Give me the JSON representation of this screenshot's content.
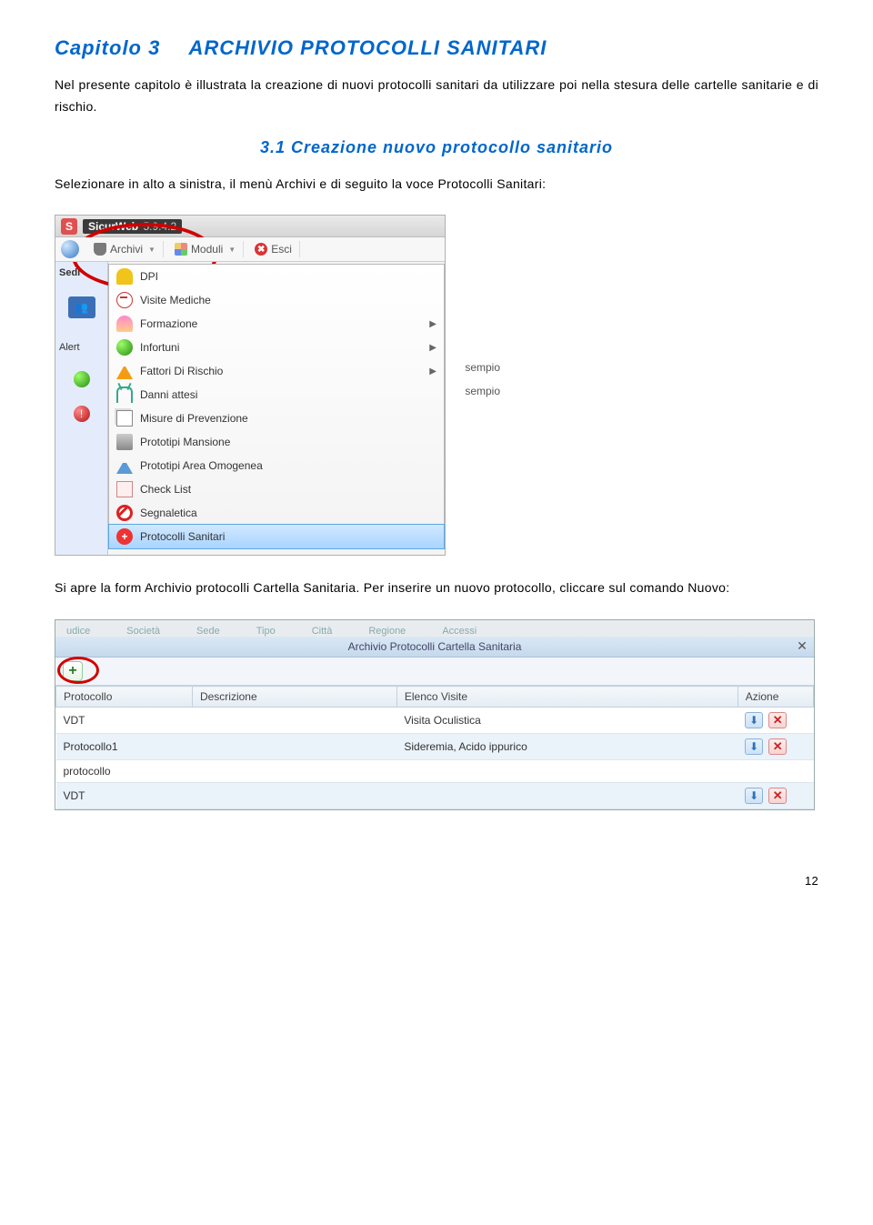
{
  "chapter": {
    "number": "Capitolo 3",
    "title": "ARCHIVIO PROTOCOLLI SANITARI"
  },
  "intro": "Nel presente capitolo è illustrata la creazione di nuovi protocolli sanitari da utilizzare poi nella stesura delle cartelle sanitarie e di rischio.",
  "section": {
    "number": "3.1",
    "title": "Creazione nuovo protocollo sanitario"
  },
  "para2": "Selezionare in alto a sinistra, il menù Archivi e di seguito la voce Protocolli Sanitari:",
  "para3": "Si apre la form Archivio protocolli Cartella Sanitaria. Per inserire un nuovo protocollo, cliccare sul comando Nuovo:",
  "page_number": "12",
  "app": {
    "logo_letter": "S",
    "name": "SicurWeb",
    "version": "5.9.4.2",
    "toolbar": {
      "archivi": "Archivi",
      "moduli": "Moduli",
      "esci": "Esci"
    },
    "sidebar": {
      "sedi": "Sedi",
      "alert": "Alert"
    },
    "menu": [
      {
        "icon": "dpi",
        "label": "DPI"
      },
      {
        "icon": "visite",
        "label": "Visite Mediche"
      },
      {
        "icon": "form",
        "label": "Formazione",
        "submenu": true
      },
      {
        "icon": "inf",
        "label": "Infortuni",
        "submenu": true
      },
      {
        "icon": "fatt",
        "label": "Fattori Di Rischio",
        "submenu": true,
        "tag": "sempio"
      },
      {
        "icon": "danni",
        "label": "Danni attesi",
        "tag": "sempio"
      },
      {
        "icon": "doc",
        "label": "Misure di Prevenzione"
      },
      {
        "icon": "proto",
        "label": "Prototipi Mansione"
      },
      {
        "icon": "area",
        "label": "Prototipi Area Omogenea"
      },
      {
        "icon": "check",
        "label": "Check List"
      },
      {
        "icon": "segn",
        "label": "Segnaletica"
      },
      {
        "icon": "plus",
        "label": "Protocolli Sanitari",
        "selected": true
      }
    ]
  },
  "grid": {
    "title": "Archivio Protocolli Cartella Sanitaria",
    "ghost_tabs": [
      "udice",
      "Società",
      "Sede",
      "Tipo",
      "Città",
      "Regione",
      "Accessi"
    ],
    "columns": [
      "Protocollo",
      "Descrizione",
      "Elenco Visite",
      "Azione"
    ],
    "rows": [
      {
        "protocollo": "VDT",
        "descrizione": "",
        "visite": "Visita Oculistica",
        "actions": true
      },
      {
        "protocollo": "Protocollo1",
        "descrizione": "",
        "visite": "Sideremia, Acido ippurico",
        "actions": true
      },
      {
        "protocollo": "protocollo",
        "descrizione": "",
        "visite": "",
        "actions": false
      },
      {
        "protocollo": "VDT",
        "descrizione": "",
        "visite": "",
        "actions": true
      }
    ]
  }
}
